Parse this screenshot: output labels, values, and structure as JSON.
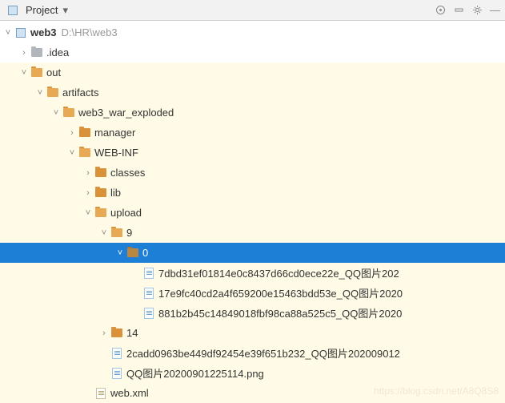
{
  "toolbar": {
    "title": "Project"
  },
  "tree": {
    "root": {
      "name": "web3",
      "path": "D:\\HR\\web3"
    },
    "idea": ".idea",
    "out": "out",
    "artifacts": "artifacts",
    "exploded": "web3_war_exploded",
    "manager": "manager",
    "webinf": "WEB-INF",
    "classes": "classes",
    "lib": "lib",
    "upload": "upload",
    "f9": "9",
    "f0": "0",
    "files0": [
      "7dbd31ef01814e0c8437d66cd0ece22e_QQ图片202",
      "17e9fc40cd2a4f659200e15463bdd53e_QQ图片2020",
      "881b2b45c14849018fbf98ca88a525c5_QQ图片2020"
    ],
    "f14": "14",
    "file_upload1": "2cadd0963be449df92454e39f651b232_QQ图片202009012",
    "file_upload2": "QQ图片20200901225114.png",
    "webxml": "web.xml"
  },
  "watermark": "https://blog.csdn.net/A8Q8S8"
}
